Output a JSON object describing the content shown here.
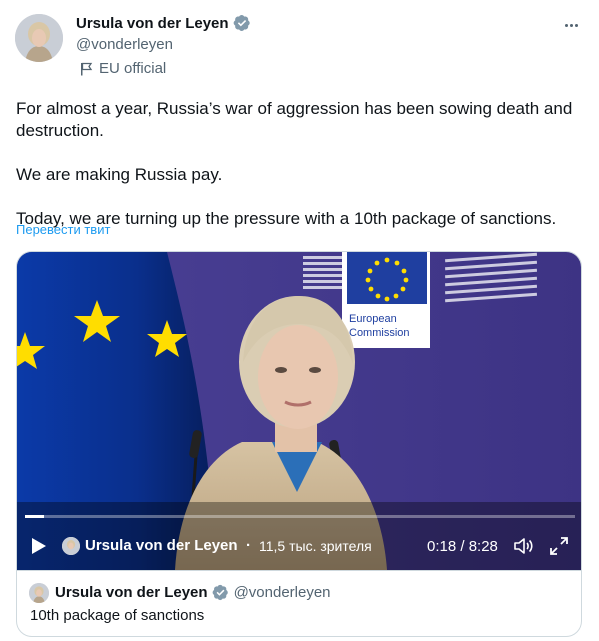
{
  "author": {
    "display_name": "Ursula von der Leyen",
    "handle": "@vonderleyen",
    "affiliation_label": "EU official",
    "verified_color": "#829aab"
  },
  "tweet": {
    "paragraphs": [
      "For almost a year, Russia’s war of aggression has been sowing death and destruction.",
      "We are making Russia pay.",
      "Today, we are turning up the pressure with a 10th package of sanctions."
    ],
    "translate_link": "Перевести твит"
  },
  "video": {
    "channel_name": "Ursula von der Leyen",
    "separator": "·",
    "views": "11,5 тыс. зрителя",
    "time_display": "0:18 / 8:28",
    "progress": 0.035,
    "backdrop_text_line1": "European",
    "backdrop_text_line2": "Commission",
    "colors": {
      "backdrop": "#4a3f8f",
      "flag_blue": "#003399",
      "star_yellow": "#ffdd00"
    }
  },
  "quote": {
    "display_name": "Ursula von der Leyen",
    "handle": "@vonderleyen",
    "text": "10th package of sanctions"
  },
  "icons": [
    "verified-badge-icon",
    "flag-icon",
    "more-icon",
    "play-icon",
    "volume-icon",
    "fullscreen-icon"
  ]
}
